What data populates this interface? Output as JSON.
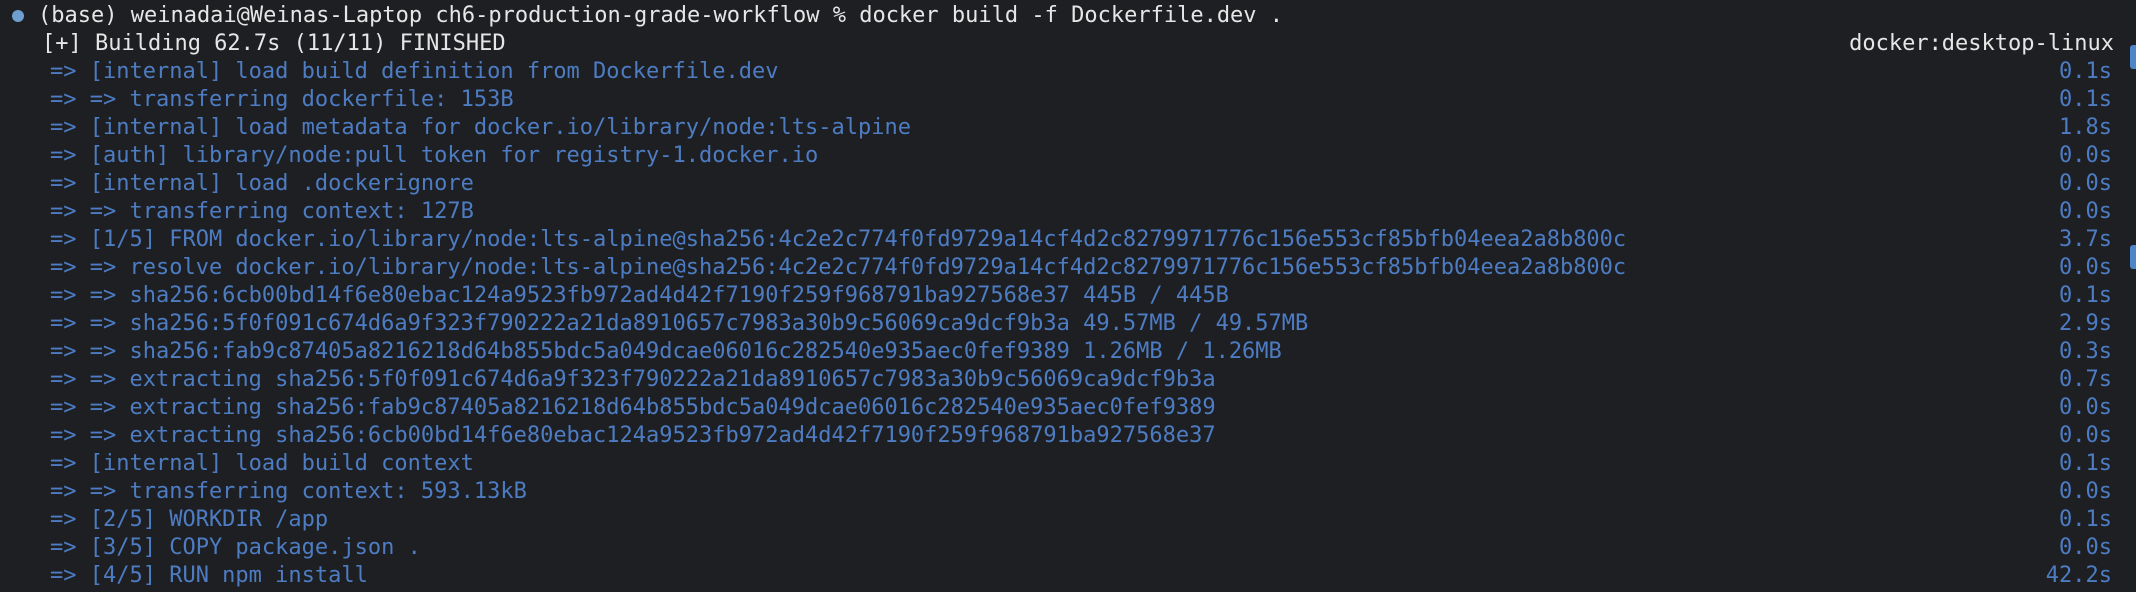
{
  "colors": {
    "background": "#1e1f22",
    "foreground": "#e6e6e6",
    "step_blue": "#4d7cc3",
    "prompt_dot": "#6f9fd1"
  },
  "terminal": {
    "prompt": "(base) weinadai@Weinas-Laptop ch6-production-grade-workflow % docker build -f Dockerfile.dev .",
    "status": "[+] Building 62.7s (11/11) FINISHED",
    "context": "docker:desktop-linux",
    "steps": [
      {
        "text": "=> [internal] load build definition from Dockerfile.dev",
        "time": "0.1s"
      },
      {
        "text": "=> => transferring dockerfile: 153B",
        "time": "0.1s"
      },
      {
        "text": "=> [internal] load metadata for docker.io/library/node:lts-alpine",
        "time": "1.8s"
      },
      {
        "text": "=> [auth] library/node:pull token for registry-1.docker.io",
        "time": "0.0s"
      },
      {
        "text": "=> [internal] load .dockerignore",
        "time": "0.0s"
      },
      {
        "text": "=> => transferring context: 127B",
        "time": "0.0s"
      },
      {
        "text": "=> [1/5] FROM docker.io/library/node:lts-alpine@sha256:4c2e2c774f0fd9729a14cf4d2c8279971776c156e553cf85bfb04eea2a8b800c",
        "time": "3.7s"
      },
      {
        "text": "=> => resolve docker.io/library/node:lts-alpine@sha256:4c2e2c774f0fd9729a14cf4d2c8279971776c156e553cf85bfb04eea2a8b800c",
        "time": "0.0s"
      },
      {
        "text": "=> => sha256:6cb00bd14f6e80ebac124a9523fb972ad4d42f7190f259f968791ba927568e37 445B / 445B",
        "time": "0.1s"
      },
      {
        "text": "=> => sha256:5f0f091c674d6a9f323f790222a21da8910657c7983a30b9c56069ca9dcf9b3a 49.57MB / 49.57MB",
        "time": "2.9s"
      },
      {
        "text": "=> => sha256:fab9c87405a8216218d64b855bdc5a049dcae06016c282540e935aec0fef9389 1.26MB / 1.26MB",
        "time": "0.3s"
      },
      {
        "text": "=> => extracting sha256:5f0f091c674d6a9f323f790222a21da8910657c7983a30b9c56069ca9dcf9b3a",
        "time": "0.7s"
      },
      {
        "text": "=> => extracting sha256:fab9c87405a8216218d64b855bdc5a049dcae06016c282540e935aec0fef9389",
        "time": "0.0s"
      },
      {
        "text": "=> => extracting sha256:6cb00bd14f6e80ebac124a9523fb972ad4d42f7190f259f968791ba927568e37",
        "time": "0.0s"
      },
      {
        "text": "=> [internal] load build context",
        "time": "0.1s"
      },
      {
        "text": "=> => transferring context: 593.13kB",
        "time": "0.0s"
      },
      {
        "text": "=> [2/5] WORKDIR /app",
        "time": "0.1s"
      },
      {
        "text": "=> [3/5] COPY package.json .",
        "time": "0.0s"
      },
      {
        "text": "=> [4/5] RUN npm install",
        "time": "42.2s"
      }
    ]
  }
}
